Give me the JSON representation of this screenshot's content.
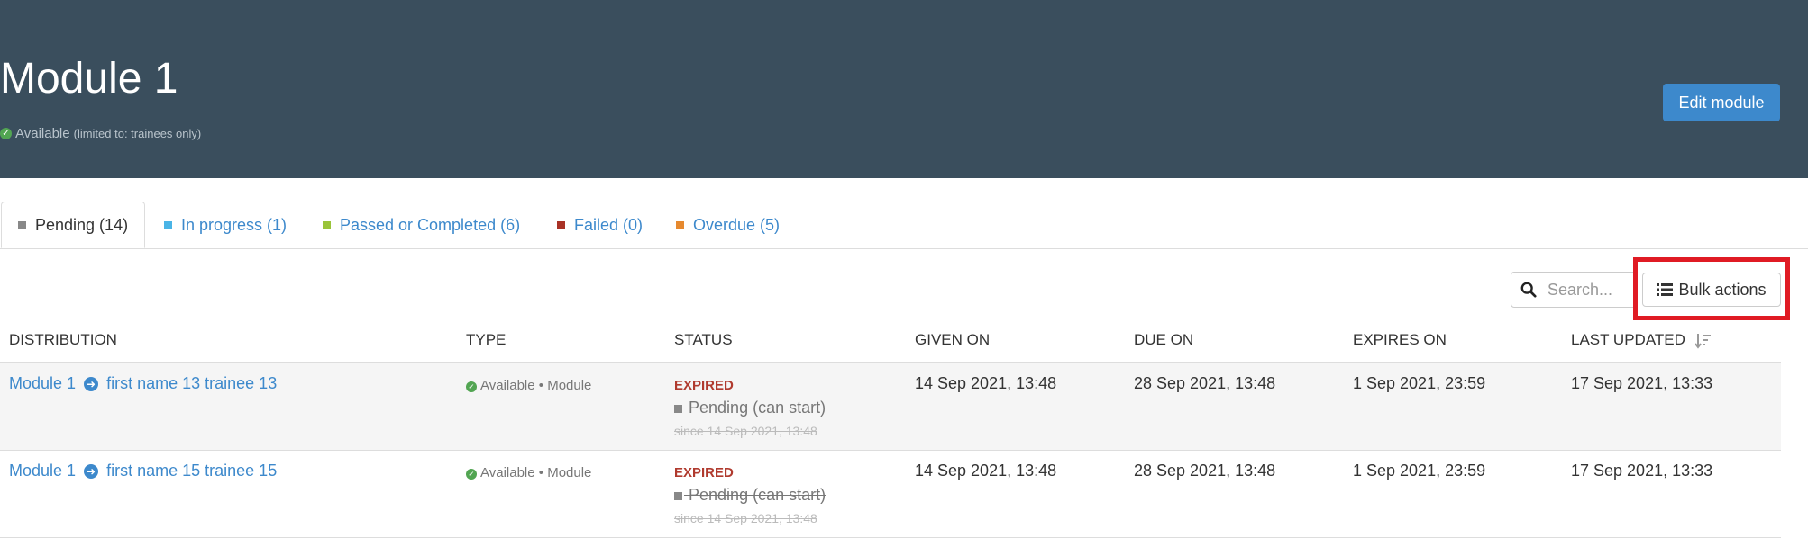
{
  "header": {
    "title": "Module 1",
    "availability": "Available",
    "availability_note": "(limited to: trainees only)",
    "edit_label": "Edit module"
  },
  "tabs": [
    {
      "label": "Pending (14)",
      "color": "#888888"
    },
    {
      "label": "In progress (1)",
      "color": "#4ab4e6"
    },
    {
      "label": "Passed or Completed (6)",
      "color": "#9ac43a"
    },
    {
      "label": "Failed (0)",
      "color": "#a93226"
    },
    {
      "label": "Overdue (5)",
      "color": "#e6892f"
    }
  ],
  "toolbar": {
    "search_placeholder": "Search...",
    "bulk_label": "Bulk actions"
  },
  "table": {
    "columns": [
      "DISTRIBUTION",
      "TYPE",
      "STATUS",
      "GIVEN ON",
      "DUE ON",
      "EXPIRES ON",
      "LAST UPDATED"
    ],
    "rows": [
      {
        "module": "Module 1",
        "trainee": "first name 13 trainee 13",
        "type_status": "Available",
        "type_kind": "Module",
        "status": "EXPIRED",
        "substatus": "Pending (can start)",
        "since": "since 14 Sep 2021, 13:48",
        "given_on": "14 Sep 2021, 13:48",
        "due_on": "28 Sep 2021, 13:48",
        "expires_on": "1 Sep 2021, 23:59",
        "last_updated": "17 Sep 2021, 13:33"
      },
      {
        "module": "Module 1",
        "trainee": "first name 15 trainee 15",
        "type_status": "Available",
        "type_kind": "Module",
        "status": "EXPIRED",
        "substatus": "Pending (can start)",
        "since": "since 14 Sep 2021, 13:48",
        "given_on": "14 Sep 2021, 13:48",
        "due_on": "28 Sep 2021, 13:48",
        "expires_on": "1 Sep 2021, 23:59",
        "last_updated": "17 Sep 2021, 13:33"
      }
    ]
  }
}
